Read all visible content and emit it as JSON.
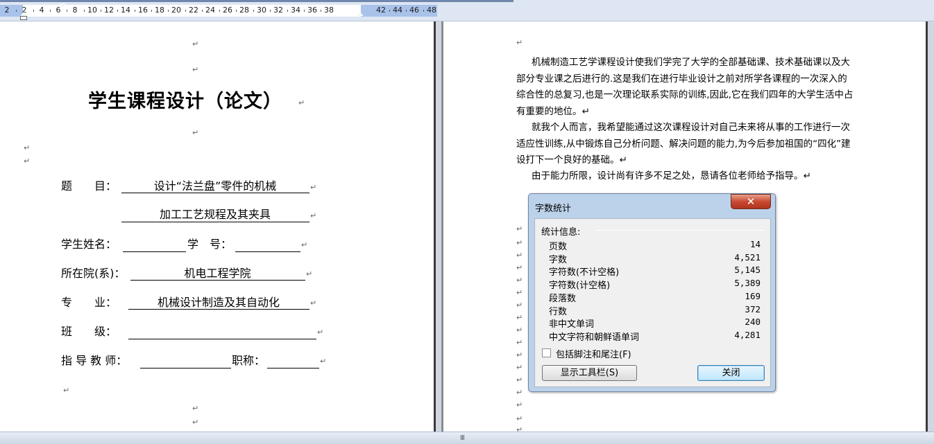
{
  "ruler": {
    "numbers": [
      "2",
      "2",
      "4",
      "6",
      "8",
      "10",
      "12",
      "14",
      "16",
      "18",
      "20",
      "22",
      "24",
      "26",
      "28",
      "30",
      "32",
      "34",
      "36",
      "38",
      "42",
      "44",
      "46",
      "48"
    ]
  },
  "left_page": {
    "title": "学生课程设计（论文）",
    "paragraph_mark": "↵",
    "form": {
      "topic_label": "题　　目：",
      "topic_line1": "设计“法兰盘”零件的机械",
      "topic_line2": "加工工艺规程及其夹具",
      "student_label": "学生姓名：",
      "student_value": "",
      "id_label": "学　号：",
      "id_value": "",
      "dept_label": "所在院(系)：",
      "dept_value": "机电工程学院",
      "major_label": "专　　业：",
      "major_value": "机械设计制造及其自动化",
      "class_label": "班　　级：",
      "class_value": "",
      "advisor_label": "指 导 教 师：",
      "advisor_value": "",
      "rank_label": "职称：",
      "rank_value": ""
    }
  },
  "right_page": {
    "paragraphs": [
      "机械制造工艺学课程设计使我们学完了大学的全部基础课、技术基础课以及大部分专业课之后进行的.这是我们在进行毕业设计之前对所学各课程的一次深入的综合性的总复习,也是一次理论联系实际的训练,因此,它在我们四年的大学生活中占有重要的地位。↵",
      "就我个人而言，我希望能通过这次课程设计对自己未来将从事的工作进行一次适应性训练,从中锻炼自己分析问题、解决问题的能力,为今后参加祖国的“四化”建设打下一个良好的基础。↵",
      "由于能力所限，设计尚有许多不足之处，恳请各位老师给予指导。↵"
    ]
  },
  "dialog": {
    "title": "字数统计",
    "close_glyph": "✕",
    "section_label": "统计信息:",
    "stats": [
      {
        "label": "页数",
        "value": "14"
      },
      {
        "label": "字数",
        "value": "4,521"
      },
      {
        "label": "字符数(不计空格)",
        "value": "5,145"
      },
      {
        "label": "字符数(计空格)",
        "value": "5,389"
      },
      {
        "label": "段落数",
        "value": "169"
      },
      {
        "label": "行数",
        "value": "372"
      },
      {
        "label": "非中文单词",
        "value": "240"
      },
      {
        "label": "中文字符和朝鲜语单词",
        "value": "4,281"
      }
    ],
    "checkbox_label": "包括脚注和尾注(F)",
    "checkbox_checked": false,
    "toolbar_button": "显示工具栏(S)",
    "close_button": "关闭"
  },
  "status": {
    "splitter_grip": "III"
  },
  "colors": {
    "ruler_band": "#a9c2ea",
    "dialog_frame": "#bcd2ea",
    "close_red": "#c84a32"
  }
}
